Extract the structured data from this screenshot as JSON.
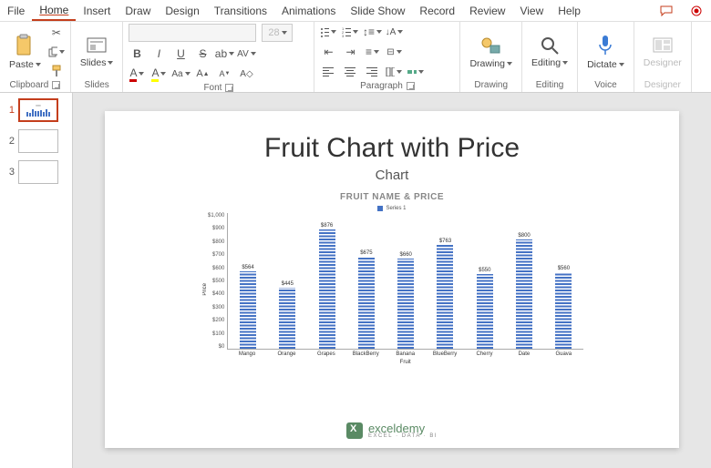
{
  "menu": {
    "items": [
      "File",
      "Home",
      "Insert",
      "Draw",
      "Design",
      "Transitions",
      "Animations",
      "Slide Show",
      "Record",
      "Review",
      "View",
      "Help"
    ],
    "active_index": 1
  },
  "ribbon": {
    "clipboard": {
      "label": "Clipboard",
      "paste": "Paste"
    },
    "slides": {
      "label": "Slides",
      "btn": "Slides"
    },
    "font": {
      "label": "Font",
      "size": "28"
    },
    "paragraph": {
      "label": "Paragraph"
    },
    "drawing": {
      "label": "Drawing",
      "btn": "Drawing"
    },
    "editing": {
      "label": "Editing",
      "btn": "Editing"
    },
    "voice": {
      "label": "Voice",
      "btn": "Dictate"
    },
    "designer": {
      "label": "Designer",
      "btn": "Designer"
    }
  },
  "thumbs": [
    {
      "num": "1",
      "selected": true
    },
    {
      "num": "2",
      "selected": false
    },
    {
      "num": "3",
      "selected": false
    }
  ],
  "slide": {
    "title": "Fruit Chart with Price",
    "subtitle": "Chart"
  },
  "chart_data": {
    "type": "bar",
    "title": "FRUIT NAME & PRICE",
    "legend": "Series 1",
    "xlabel": "Fruit",
    "ylabel": "Price",
    "ylim": [
      0,
      1000
    ],
    "ytick_labels": [
      "$1,000",
      "$900",
      "$800",
      "$700",
      "$600",
      "$500",
      "$400",
      "$300",
      "$200",
      "$100",
      "$0"
    ],
    "categories": [
      "Mango",
      "Orange",
      "Grapes",
      "BlackBerry",
      "Banana",
      "BlueBerry",
      "Cherry",
      "Date",
      "Guava"
    ],
    "values": [
      564,
      445,
      876,
      675,
      660,
      763,
      550,
      800,
      560
    ],
    "value_labels": [
      "$564",
      "$445",
      "$876",
      "$675",
      "$660",
      "$763",
      "$550",
      "$800",
      "$560"
    ]
  },
  "logo": {
    "name": "exceldemy",
    "tag": "EXCEL · DATA · BI"
  }
}
